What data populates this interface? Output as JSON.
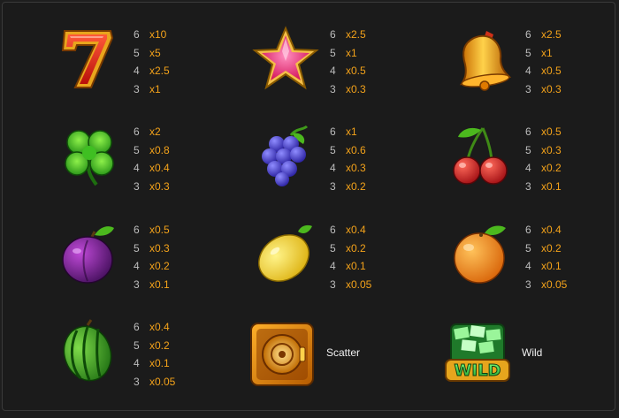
{
  "paytable": [
    {
      "symbol": "seven",
      "icon": "seven-icon",
      "pays": [
        {
          "count": "6",
          "mult": "x10"
        },
        {
          "count": "5",
          "mult": "x5"
        },
        {
          "count": "4",
          "mult": "x2.5"
        },
        {
          "count": "3",
          "mult": "x1"
        }
      ]
    },
    {
      "symbol": "star",
      "icon": "star-icon",
      "pays": [
        {
          "count": "6",
          "mult": "x2.5"
        },
        {
          "count": "5",
          "mult": "x1"
        },
        {
          "count": "4",
          "mult": "x0.5"
        },
        {
          "count": "3",
          "mult": "x0.3"
        }
      ]
    },
    {
      "symbol": "bell",
      "icon": "bell-icon",
      "pays": [
        {
          "count": "6",
          "mult": "x2.5"
        },
        {
          "count": "5",
          "mult": "x1"
        },
        {
          "count": "4",
          "mult": "x0.5"
        },
        {
          "count": "3",
          "mult": "x0.3"
        }
      ]
    },
    {
      "symbol": "clover",
      "icon": "clover-icon",
      "pays": [
        {
          "count": "6",
          "mult": "x2"
        },
        {
          "count": "5",
          "mult": "x0.8"
        },
        {
          "count": "4",
          "mult": "x0.4"
        },
        {
          "count": "3",
          "mult": "x0.3"
        }
      ]
    },
    {
      "symbol": "grapes",
      "icon": "grapes-icon",
      "pays": [
        {
          "count": "6",
          "mult": "x1"
        },
        {
          "count": "5",
          "mult": "x0.6"
        },
        {
          "count": "4",
          "mult": "x0.3"
        },
        {
          "count": "3",
          "mult": "x0.2"
        }
      ]
    },
    {
      "symbol": "cherries",
      "icon": "cherries-icon",
      "pays": [
        {
          "count": "6",
          "mult": "x0.5"
        },
        {
          "count": "5",
          "mult": "x0.3"
        },
        {
          "count": "4",
          "mult": "x0.2"
        },
        {
          "count": "3",
          "mult": "x0.1"
        }
      ]
    },
    {
      "symbol": "plum",
      "icon": "plum-icon",
      "pays": [
        {
          "count": "6",
          "mult": "x0.5"
        },
        {
          "count": "5",
          "mult": "x0.3"
        },
        {
          "count": "4",
          "mult": "x0.2"
        },
        {
          "count": "3",
          "mult": "x0.1"
        }
      ]
    },
    {
      "symbol": "lemon",
      "icon": "lemon-icon",
      "pays": [
        {
          "count": "6",
          "mult": "x0.4"
        },
        {
          "count": "5",
          "mult": "x0.2"
        },
        {
          "count": "4",
          "mult": "x0.1"
        },
        {
          "count": "3",
          "mult": "x0.05"
        }
      ]
    },
    {
      "symbol": "orange",
      "icon": "orange-icon",
      "pays": [
        {
          "count": "6",
          "mult": "x0.4"
        },
        {
          "count": "5",
          "mult": "x0.2"
        },
        {
          "count": "4",
          "mult": "x0.1"
        },
        {
          "count": "3",
          "mult": "x0.05"
        }
      ]
    },
    {
      "symbol": "watermelon",
      "icon": "watermelon-icon",
      "pays": [
        {
          "count": "6",
          "mult": "x0.4"
        },
        {
          "count": "5",
          "mult": "x0.2"
        },
        {
          "count": "4",
          "mult": "x0.1"
        },
        {
          "count": "3",
          "mult": "x0.05"
        }
      ]
    }
  ],
  "scatter": {
    "icon": "vault-scatter-icon",
    "label": "Scatter"
  },
  "wild": {
    "icon": "wild-icon",
    "label": "Wild",
    "badge_text": "WILD"
  },
  "colors": {
    "multiplier": "#f3a21a",
    "count": "#bdbdbd",
    "label": "#f0f0f0",
    "background": "#1b1b1b"
  }
}
